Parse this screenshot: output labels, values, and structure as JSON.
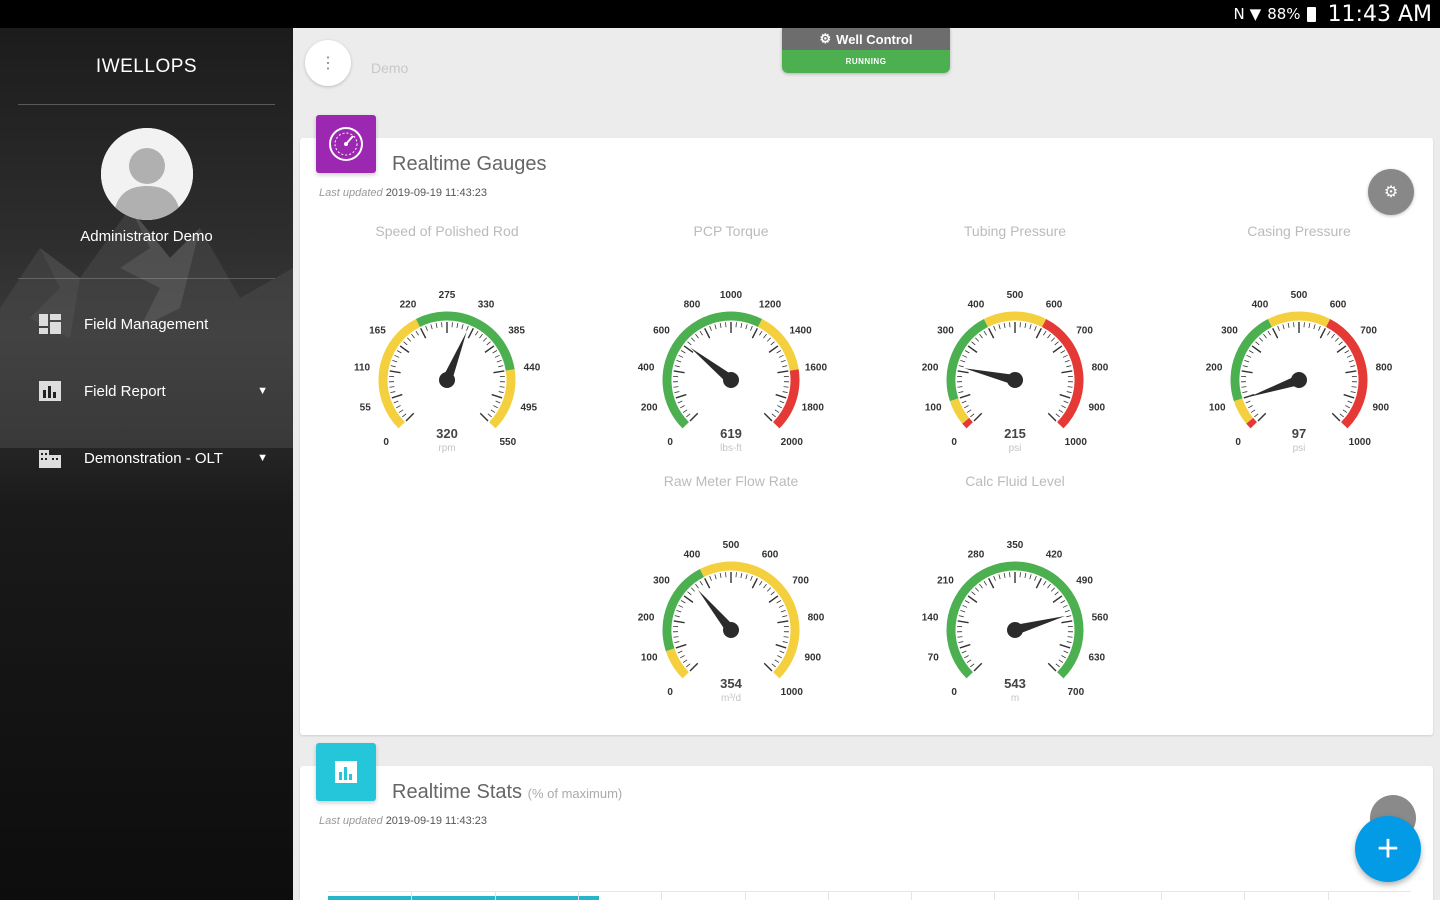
{
  "status_bar": {
    "icons": [
      "nfc-icon",
      "wifi-icon"
    ],
    "battery": "88%",
    "time": "11:43 AM"
  },
  "sidebar": {
    "brand": "IWELLOPS",
    "user_name": "Administrator Demo",
    "items": [
      {
        "label": "Field Management",
        "icon": "dashboard-icon",
        "has_caret": false
      },
      {
        "label": "Field Report",
        "icon": "report-icon",
        "has_caret": true
      },
      {
        "label": "Demonstration - OLT",
        "icon": "building-icon",
        "has_caret": true
      }
    ]
  },
  "header": {
    "breadcrumb": "Demo",
    "well_control": {
      "label": "Well Control",
      "status": "RUNNING",
      "status_color": "#4caf50"
    }
  },
  "gauges_card": {
    "title": "Realtime Gauges",
    "updated_label": "Last updated",
    "updated_value": "2019-09-19 11:43:23",
    "badge_color": "#9c27b0",
    "gauges": [
      {
        "title": "Speed of Polished Rod",
        "value": 320,
        "unit": "rpm",
        "min": 0,
        "max": 550,
        "labels": [
          "0",
          "55",
          "110",
          "165",
          "220",
          "275",
          "330",
          "385",
          "440",
          "495",
          "550"
        ],
        "zones": [
          [
            "#f4d03f",
            0,
            0.4
          ],
          [
            "#4caf50",
            0.4,
            0.8
          ],
          [
            "#f4d03f",
            0.8,
            1
          ]
        ]
      },
      {
        "title": "PCP Torque",
        "value": 619,
        "unit": "lbs-ft",
        "min": 0,
        "max": 2000,
        "labels": [
          "0",
          "200",
          "400",
          "600",
          "800",
          "1000",
          "1200",
          "1400",
          "1600",
          "1800",
          "2000"
        ],
        "zones": [
          [
            "#4caf50",
            0,
            0.6
          ],
          [
            "#f4d03f",
            0.6,
            0.8
          ],
          [
            "#e53935",
            0.8,
            1
          ]
        ]
      },
      {
        "title": "Tubing Pressure",
        "value": 215,
        "unit": "psi",
        "min": 0,
        "max": 1000,
        "labels": [
          "0",
          "100",
          "200",
          "300",
          "400",
          "500",
          "600",
          "700",
          "800",
          "900",
          "1000"
        ],
        "zones": [
          [
            "#e53935",
            0,
            0.02
          ],
          [
            "#f4d03f",
            0.02,
            0.1
          ],
          [
            "#4caf50",
            0.1,
            0.4
          ],
          [
            "#f4d03f",
            0.4,
            0.6
          ],
          [
            "#e53935",
            0.6,
            1
          ]
        ]
      },
      {
        "title": "Casing Pressure",
        "value": 97,
        "unit": "psi",
        "min": 0,
        "max": 1000,
        "labels": [
          "0",
          "100",
          "200",
          "300",
          "400",
          "500",
          "600",
          "700",
          "800",
          "900",
          "1000"
        ],
        "zones": [
          [
            "#e53935",
            0,
            0.02
          ],
          [
            "#f4d03f",
            0.02,
            0.1
          ],
          [
            "#4caf50",
            0.1,
            0.4
          ],
          [
            "#f4d03f",
            0.4,
            0.6
          ],
          [
            "#e53935",
            0.6,
            1
          ]
        ]
      },
      {
        "title": "Raw Meter Flow Rate",
        "value": 354,
        "unit": "m³/d",
        "min": 0,
        "max": 1000,
        "labels": [
          "0",
          "100",
          "200",
          "300",
          "400",
          "500",
          "600",
          "700",
          "800",
          "900",
          "1000"
        ],
        "zones": [
          [
            "#f4d03f",
            0,
            0.1
          ],
          [
            "#4caf50",
            0.1,
            0.4
          ],
          [
            "#f4d03f",
            0.4,
            1
          ]
        ]
      },
      {
        "title": "Calc Fluid Level",
        "value": 543,
        "unit": "m",
        "min": 0,
        "max": 700,
        "labels": [
          "0",
          "70",
          "140",
          "210",
          "280",
          "350",
          "420",
          "490",
          "560",
          "630",
          "700"
        ],
        "zones": [
          [
            "#4caf50",
            0,
            1
          ]
        ]
      }
    ]
  },
  "stats_card": {
    "title": "Realtime Stats",
    "subtitle": "(% of maximum)",
    "updated_label": "Last updated",
    "updated_value": "2019-09-19 11:43:23",
    "badge_color": "#26c6da",
    "progress": 0.25
  },
  "fab": {
    "label": "+",
    "color": "#039be5"
  }
}
